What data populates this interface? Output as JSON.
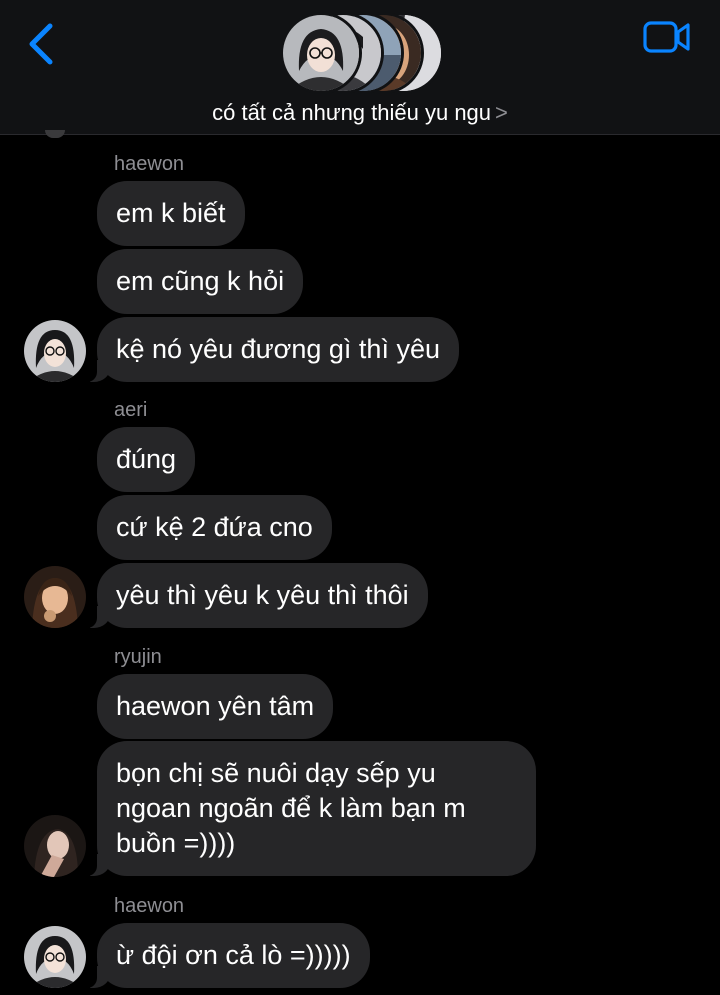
{
  "header": {
    "group_name": "có tất cả nhưng thiếu yu ngu",
    "chevron": ">",
    "icons": [
      "back-chevron-icon",
      "video-call-icon"
    ],
    "accent_color": "#0a84ff"
  },
  "messages": [
    {
      "sender": "haewon",
      "texts": [
        "em k biết",
        "em cũng k hỏi",
        "kệ nó yêu đương gì thì yêu"
      ]
    },
    {
      "sender": "aeri",
      "texts": [
        "đúng",
        "cứ kệ 2 đứa cno",
        "yêu thì yêu k yêu thì thôi"
      ]
    },
    {
      "sender": "ryujin",
      "texts": [
        "haewon yên tâm",
        "bọn chị sẽ nuôi dạy sếp yu ngoan ngoãn để k làm bạn m buồn =))))"
      ]
    },
    {
      "sender": "haewon",
      "texts": [
        "ừ đội ơn cả lò =)))))"
      ]
    }
  ],
  "colors": {
    "bubble": "#262628",
    "sender_name": "#8e8e93",
    "background": "#000000",
    "header_bg": "#111214"
  }
}
